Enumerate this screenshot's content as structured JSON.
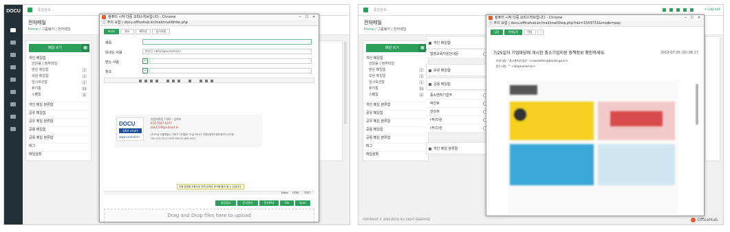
{
  "app": {
    "logo": "DOCU",
    "search_placeholder": "통합검색...",
    "page_title": "전자메일",
    "breadcrumb": [
      "Home",
      "그룹웨어",
      "전자메일"
    ],
    "footer_copyright": "COPYRIGHT © 2016 DOCU ALL RIGHT RESERVED",
    "footer_brand": "OfficeHub",
    "logout": "Log out"
  },
  "leftnav": {
    "compose_label": "메일 쓰기",
    "personal_header": "개인 메일함",
    "personal_items": [
      {
        "label": "안읽음",
        "extra": "첨부파일",
        "count": ""
      },
      {
        "label": "받은 메일함",
        "count": "7"
      },
      {
        "label": "보낸 메일함",
        "count": "3"
      },
      {
        "label": "임시보관함",
        "count": "1"
      },
      {
        "label": "휴지통",
        "count": "34"
      },
      {
        "label": "스팸함",
        "count": "8"
      }
    ],
    "sections": [
      "개인 메일 분류함",
      "공유 메일함",
      "공유 메일 분류함",
      "공용 메일함",
      "공용 메일 분류함",
      "태그"
    ],
    "settings": "메일설정"
  },
  "compose_window": {
    "title": "컴퓨터 시작 다중 오피스허브입니다 - Chrome",
    "url_security": "주의 요함",
    "url": "docu.officehub.kr/mail/mailWrite.php",
    "tabs": [
      "보내기",
      "취소",
      "재작성",
      "임시저장"
    ],
    "subject_label": "제목",
    "sender_label": "보내는 사람",
    "sender_value": "변유진 <b0u3@sumart.kr>",
    "to_label": "받는 사람",
    "cc_label": "참조",
    "signature": {
      "logo_top": "DOCU",
      "logo_sub": "Q&A smart",
      "name_line": "영업지원팀 / 대리 · 김희조",
      "phone": "070-7087-6377",
      "email": "kbk1129@sumart.kr",
      "url": "www.sumart.kr",
      "address": "(주)도큐 서울특별시 구로구 디지털로 31길 38-21 이앤씨벤처드림타워3차 207호",
      "contact": "TEL 070-7117-7979 FAX 02-830-3417"
    },
    "notice": "이용 방법을 도움으로 하며 입력된 문서를 불러 올 수 있습니다",
    "editor_modes": [
      "Editor",
      "HTML",
      "TEXT"
    ],
    "attach_buttons": [
      "내컴퓨터",
      "문서관리",
      "전자PAX",
      "File",
      "Scan"
    ],
    "dropzone": "Drag and Drop files here to upload"
  },
  "view_window": {
    "title": "컴퓨터 시작 다중 오피스허브입니다 - Chrome",
    "url_security": "주의 요함",
    "url": "docu.officehub.kr/mail/mailView.php?idx=1543731&mode=pop",
    "buttons": [
      "답장",
      "전체답장",
      "전달"
    ],
    "subject": "7/25일자 기업마당에 게시된 중소기업지원 정책정보 확인하세요.",
    "date": "2019-07-25 (목) 08:17",
    "sender_label": "보낸사람",
    "sender_value": "\"중소벤처기업부\" <newsletter@bizinfo.go.kr>",
    "receiver_label": "받는사람",
    "receiver_value": "\"\" <all@sumart.kr>"
  },
  "right_panel": {
    "personal_box": "개인 메일함",
    "notice_row": "법정교육지원안내문",
    "sent_box": "보낸 메일함",
    "shared_box": "공용 메일함",
    "shared_rows": [
      "중소벤처기업부",
      "박진호",
      "한성주",
      "(주)다원",
      "(주)다원"
    ],
    "personal_class_box": "개인 메일 분류함"
  },
  "colors": {
    "accent": "#2e9f5b",
    "sidebar": "#243038"
  }
}
